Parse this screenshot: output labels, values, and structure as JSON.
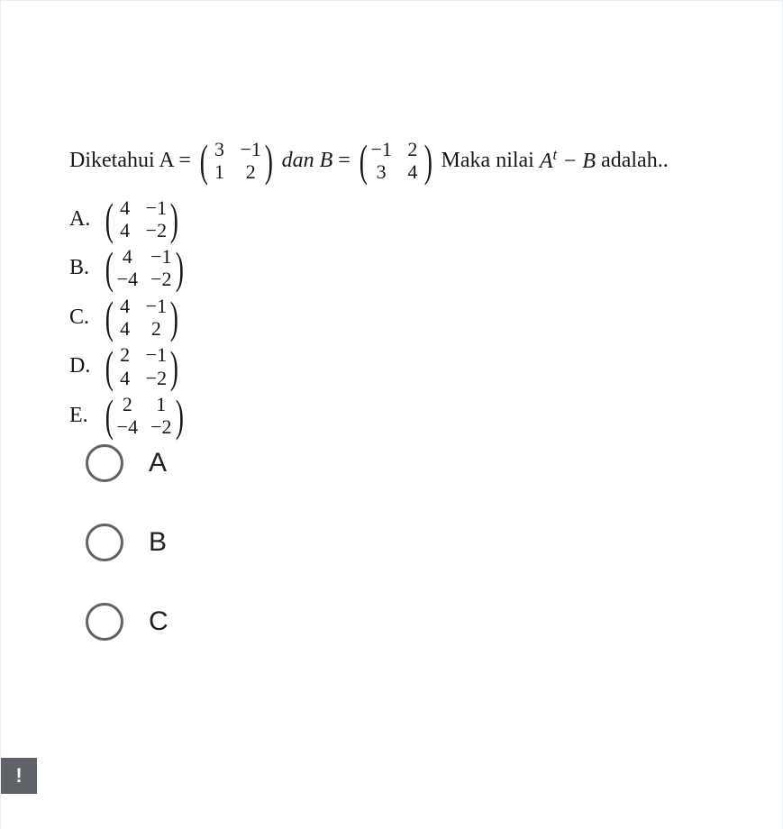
{
  "question": {
    "prefix": "Diketahui A =",
    "matA": {
      "a11": "3",
      "a12": "−1",
      "a21": "1",
      "a22": "2"
    },
    "mid1": "dan B",
    "eq1": "=",
    "matB": {
      "a11": "−1",
      "a12": "2",
      "a21": "3",
      "a22": "4"
    },
    "tail1": "Maka nilai",
    "tailExpr1": "A",
    "tailSup": "t",
    "tailExpr2": " − B",
    "tail2": " adalah.."
  },
  "choicesInline": {
    "A": {
      "label": "A.",
      "a11": "4",
      "a12": "−1",
      "a21": "4",
      "a22": "−2"
    },
    "B": {
      "label": "B.",
      "a11": "4",
      "a12": "−1",
      "a21": "−4",
      "a22": "−2"
    },
    "C": {
      "label": "C.",
      "a11": "4",
      "a12": "−1",
      "a21": "4",
      "a22": "2"
    },
    "D": {
      "label": "D.",
      "a11": "2",
      "a12": "−1",
      "a21": "4",
      "a22": "−2"
    },
    "E": {
      "label": "E.",
      "a11": "2",
      "a12": "1",
      "a21": "−4",
      "a22": "−2"
    }
  },
  "radioOptions": {
    "A": "A",
    "B": "B",
    "C": "C"
  },
  "feedback": {
    "glyph": "!"
  }
}
